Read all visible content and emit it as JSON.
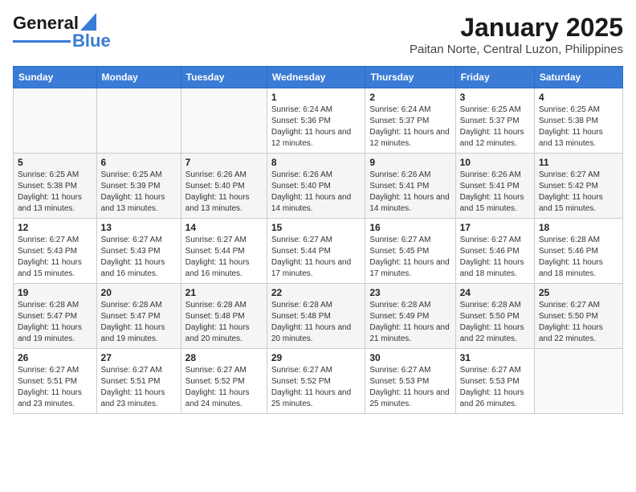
{
  "header": {
    "logo_general": "General",
    "logo_blue": "Blue",
    "title": "January 2025",
    "subtitle": "Paitan Norte, Central Luzon, Philippines"
  },
  "days_of_week": [
    "Sunday",
    "Monday",
    "Tuesday",
    "Wednesday",
    "Thursday",
    "Friday",
    "Saturday"
  ],
  "weeks": [
    [
      {
        "day": "",
        "info": ""
      },
      {
        "day": "",
        "info": ""
      },
      {
        "day": "",
        "info": ""
      },
      {
        "day": "1",
        "info": "Sunrise: 6:24 AM\nSunset: 5:36 PM\nDaylight: 11 hours and 12 minutes."
      },
      {
        "day": "2",
        "info": "Sunrise: 6:24 AM\nSunset: 5:37 PM\nDaylight: 11 hours and 12 minutes."
      },
      {
        "day": "3",
        "info": "Sunrise: 6:25 AM\nSunset: 5:37 PM\nDaylight: 11 hours and 12 minutes."
      },
      {
        "day": "4",
        "info": "Sunrise: 6:25 AM\nSunset: 5:38 PM\nDaylight: 11 hours and 13 minutes."
      }
    ],
    [
      {
        "day": "5",
        "info": "Sunrise: 6:25 AM\nSunset: 5:38 PM\nDaylight: 11 hours and 13 minutes."
      },
      {
        "day": "6",
        "info": "Sunrise: 6:25 AM\nSunset: 5:39 PM\nDaylight: 11 hours and 13 minutes."
      },
      {
        "day": "7",
        "info": "Sunrise: 6:26 AM\nSunset: 5:40 PM\nDaylight: 11 hours and 13 minutes."
      },
      {
        "day": "8",
        "info": "Sunrise: 6:26 AM\nSunset: 5:40 PM\nDaylight: 11 hours and 14 minutes."
      },
      {
        "day": "9",
        "info": "Sunrise: 6:26 AM\nSunset: 5:41 PM\nDaylight: 11 hours and 14 minutes."
      },
      {
        "day": "10",
        "info": "Sunrise: 6:26 AM\nSunset: 5:41 PM\nDaylight: 11 hours and 15 minutes."
      },
      {
        "day": "11",
        "info": "Sunrise: 6:27 AM\nSunset: 5:42 PM\nDaylight: 11 hours and 15 minutes."
      }
    ],
    [
      {
        "day": "12",
        "info": "Sunrise: 6:27 AM\nSunset: 5:43 PM\nDaylight: 11 hours and 15 minutes."
      },
      {
        "day": "13",
        "info": "Sunrise: 6:27 AM\nSunset: 5:43 PM\nDaylight: 11 hours and 16 minutes."
      },
      {
        "day": "14",
        "info": "Sunrise: 6:27 AM\nSunset: 5:44 PM\nDaylight: 11 hours and 16 minutes."
      },
      {
        "day": "15",
        "info": "Sunrise: 6:27 AM\nSunset: 5:44 PM\nDaylight: 11 hours and 17 minutes."
      },
      {
        "day": "16",
        "info": "Sunrise: 6:27 AM\nSunset: 5:45 PM\nDaylight: 11 hours and 17 minutes."
      },
      {
        "day": "17",
        "info": "Sunrise: 6:27 AM\nSunset: 5:46 PM\nDaylight: 11 hours and 18 minutes."
      },
      {
        "day": "18",
        "info": "Sunrise: 6:28 AM\nSunset: 5:46 PM\nDaylight: 11 hours and 18 minutes."
      }
    ],
    [
      {
        "day": "19",
        "info": "Sunrise: 6:28 AM\nSunset: 5:47 PM\nDaylight: 11 hours and 19 minutes."
      },
      {
        "day": "20",
        "info": "Sunrise: 6:28 AM\nSunset: 5:47 PM\nDaylight: 11 hours and 19 minutes."
      },
      {
        "day": "21",
        "info": "Sunrise: 6:28 AM\nSunset: 5:48 PM\nDaylight: 11 hours and 20 minutes."
      },
      {
        "day": "22",
        "info": "Sunrise: 6:28 AM\nSunset: 5:48 PM\nDaylight: 11 hours and 20 minutes."
      },
      {
        "day": "23",
        "info": "Sunrise: 6:28 AM\nSunset: 5:49 PM\nDaylight: 11 hours and 21 minutes."
      },
      {
        "day": "24",
        "info": "Sunrise: 6:28 AM\nSunset: 5:50 PM\nDaylight: 11 hours and 22 minutes."
      },
      {
        "day": "25",
        "info": "Sunrise: 6:27 AM\nSunset: 5:50 PM\nDaylight: 11 hours and 22 minutes."
      }
    ],
    [
      {
        "day": "26",
        "info": "Sunrise: 6:27 AM\nSunset: 5:51 PM\nDaylight: 11 hours and 23 minutes."
      },
      {
        "day": "27",
        "info": "Sunrise: 6:27 AM\nSunset: 5:51 PM\nDaylight: 11 hours and 23 minutes."
      },
      {
        "day": "28",
        "info": "Sunrise: 6:27 AM\nSunset: 5:52 PM\nDaylight: 11 hours and 24 minutes."
      },
      {
        "day": "29",
        "info": "Sunrise: 6:27 AM\nSunset: 5:52 PM\nDaylight: 11 hours and 25 minutes."
      },
      {
        "day": "30",
        "info": "Sunrise: 6:27 AM\nSunset: 5:53 PM\nDaylight: 11 hours and 25 minutes."
      },
      {
        "day": "31",
        "info": "Sunrise: 6:27 AM\nSunset: 5:53 PM\nDaylight: 11 hours and 26 minutes."
      },
      {
        "day": "",
        "info": ""
      }
    ]
  ]
}
